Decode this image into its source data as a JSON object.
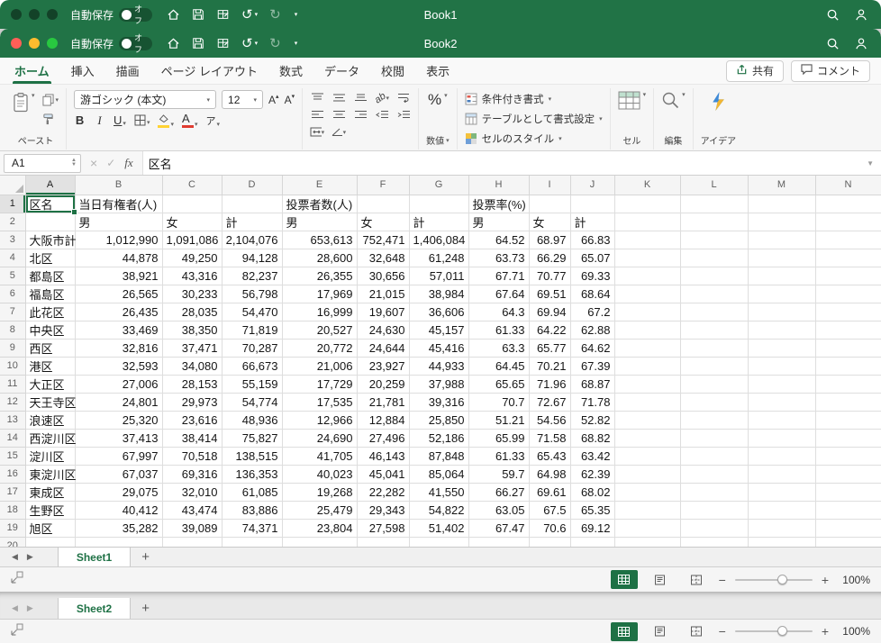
{
  "title_back": {
    "autosave": "自動保存",
    "autosave_state": "オフ",
    "title": "Book1"
  },
  "title_front": {
    "autosave": "自動保存",
    "autosave_state": "オフ",
    "title": "Book2"
  },
  "ribbon": {
    "tabs": [
      "ホーム",
      "挿入",
      "描画",
      "ページ レイアウト",
      "数式",
      "データ",
      "校閲",
      "表示"
    ],
    "active_tab": "ホーム",
    "share": "共有",
    "comments": "コメント",
    "clipboard": {
      "paste": "ペースト"
    },
    "font": {
      "name": "游ゴシック (本文)",
      "size": "12"
    },
    "number": {
      "percent": "%",
      "label": "数値"
    },
    "styles": {
      "conditional": "条件付き書式",
      "table_format": "テーブルとして書式設定",
      "cell_styles": "セルのスタイル"
    },
    "cells": {
      "label": "セル"
    },
    "editing": {
      "label": "編集"
    },
    "ideas": {
      "label": "アイデア"
    }
  },
  "formula_bar": {
    "name_box": "A1",
    "value": "区名"
  },
  "grid": {
    "active_cell": "A1",
    "columns": [
      "A",
      "B",
      "C",
      "D",
      "E",
      "F",
      "G",
      "H",
      "I",
      "J",
      "K",
      "L",
      "M",
      "N"
    ],
    "rows": [
      {
        "n": 1,
        "cells": {
          "A": "区名",
          "B": "当日有権者(人)",
          "E": "投票者数(人)",
          "H": "投票率(%)"
        }
      },
      {
        "n": 2,
        "cells": {
          "B": "男",
          "C": "女",
          "D": "計",
          "E": "男",
          "F": "女",
          "G": "計",
          "H": "男",
          "I": "女",
          "J": "計"
        }
      },
      {
        "n": 3,
        "cells": {
          "A": "大阪市計",
          "B": "1,012,990",
          "C": "1,091,086",
          "D": "2,104,076",
          "E": "653,613",
          "F": "752,471",
          "G": "1,406,084",
          "H": "64.52",
          "I": "68.97",
          "J": "66.83"
        }
      },
      {
        "n": 4,
        "cells": {
          "A": "北区",
          "B": "44,878",
          "C": "49,250",
          "D": "94,128",
          "E": "28,600",
          "F": "32,648",
          "G": "61,248",
          "H": "63.73",
          "I": "66.29",
          "J": "65.07"
        }
      },
      {
        "n": 5,
        "cells": {
          "A": "都島区",
          "B": "38,921",
          "C": "43,316",
          "D": "82,237",
          "E": "26,355",
          "F": "30,656",
          "G": "57,011",
          "H": "67.71",
          "I": "70.77",
          "J": "69.33"
        }
      },
      {
        "n": 6,
        "cells": {
          "A": "福島区",
          "B": "26,565",
          "C": "30,233",
          "D": "56,798",
          "E": "17,969",
          "F": "21,015",
          "G": "38,984",
          "H": "67.64",
          "I": "69.51",
          "J": "68.64"
        }
      },
      {
        "n": 7,
        "cells": {
          "A": "此花区",
          "B": "26,435",
          "C": "28,035",
          "D": "54,470",
          "E": "16,999",
          "F": "19,607",
          "G": "36,606",
          "H": "64.3",
          "I": "69.94",
          "J": "67.2"
        }
      },
      {
        "n": 8,
        "cells": {
          "A": "中央区",
          "B": "33,469",
          "C": "38,350",
          "D": "71,819",
          "E": "20,527",
          "F": "24,630",
          "G": "45,157",
          "H": "61.33",
          "I": "64.22",
          "J": "62.88"
        }
      },
      {
        "n": 9,
        "cells": {
          "A": "西区",
          "B": "32,816",
          "C": "37,471",
          "D": "70,287",
          "E": "20,772",
          "F": "24,644",
          "G": "45,416",
          "H": "63.3",
          "I": "65.77",
          "J": "64.62"
        }
      },
      {
        "n": 10,
        "cells": {
          "A": "港区",
          "B": "32,593",
          "C": "34,080",
          "D": "66,673",
          "E": "21,006",
          "F": "23,927",
          "G": "44,933",
          "H": "64.45",
          "I": "70.21",
          "J": "67.39"
        }
      },
      {
        "n": 11,
        "cells": {
          "A": "大正区",
          "B": "27,006",
          "C": "28,153",
          "D": "55,159",
          "E": "17,729",
          "F": "20,259",
          "G": "37,988",
          "H": "65.65",
          "I": "71.96",
          "J": "68.87"
        }
      },
      {
        "n": 12,
        "cells": {
          "A": "天王寺区",
          "B": "24,801",
          "C": "29,973",
          "D": "54,774",
          "E": "17,535",
          "F": "21,781",
          "G": "39,316",
          "H": "70.7",
          "I": "72.67",
          "J": "71.78"
        }
      },
      {
        "n": 13,
        "cells": {
          "A": "浪速区",
          "B": "25,320",
          "C": "23,616",
          "D": "48,936",
          "E": "12,966",
          "F": "12,884",
          "G": "25,850",
          "H": "51.21",
          "I": "54.56",
          "J": "52.82"
        }
      },
      {
        "n": 14,
        "cells": {
          "A": "西淀川区",
          "B": "37,413",
          "C": "38,414",
          "D": "75,827",
          "E": "24,690",
          "F": "27,496",
          "G": "52,186",
          "H": "65.99",
          "I": "71.58",
          "J": "68.82"
        }
      },
      {
        "n": 15,
        "cells": {
          "A": "淀川区",
          "B": "67,997",
          "C": "70,518",
          "D": "138,515",
          "E": "41,705",
          "F": "46,143",
          "G": "87,848",
          "H": "61.33",
          "I": "65.43",
          "J": "63.42"
        }
      },
      {
        "n": 16,
        "cells": {
          "A": "東淀川区",
          "B": "67,037",
          "C": "69,316",
          "D": "136,353",
          "E": "40,023",
          "F": "45,041",
          "G": "85,064",
          "H": "59.7",
          "I": "64.98",
          "J": "62.39"
        }
      },
      {
        "n": 17,
        "cells": {
          "A": "東成区",
          "B": "29,075",
          "C": "32,010",
          "D": "61,085",
          "E": "19,268",
          "F": "22,282",
          "G": "41,550",
          "H": "66.27",
          "I": "69.61",
          "J": "68.02"
        }
      },
      {
        "n": 18,
        "cells": {
          "A": "生野区",
          "B": "40,412",
          "C": "43,474",
          "D": "83,886",
          "E": "25,479",
          "F": "29,343",
          "G": "54,822",
          "H": "63.05",
          "I": "67.5",
          "J": "65.35"
        }
      },
      {
        "n": 19,
        "cells": {
          "A": "旭区",
          "B": "35,282",
          "C": "39,089",
          "D": "74,371",
          "E": "23,804",
          "F": "27,598",
          "G": "51,402",
          "H": "67.47",
          "I": "70.6",
          "J": "69.12"
        }
      },
      {
        "n": 20,
        "cells": {}
      }
    ]
  },
  "front_bottom": {
    "sheet_tab": "Sheet1",
    "zoom": "100%"
  },
  "back_bottom": {
    "sheet_tab": "Sheet2",
    "zoom": "100%"
  },
  "colors": {
    "accent_green": "#1e7145",
    "titlebar_green": "#217346"
  }
}
